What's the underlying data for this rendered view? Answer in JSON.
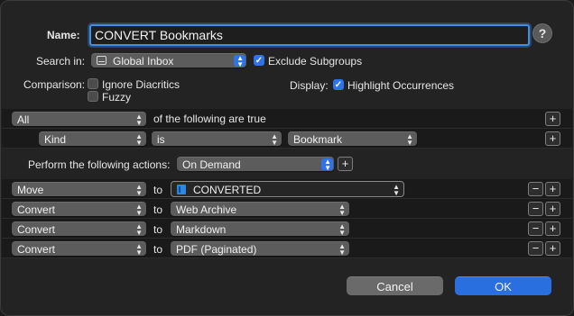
{
  "dialog": {
    "name_label": "Name:",
    "name_value": "CONVERT Bookmarks",
    "help_label": "?",
    "search_in_label": "Search in:",
    "search_in_value": "Global Inbox",
    "exclude_subgroups_label": "Exclude Subgroups",
    "exclude_subgroups_checked": true,
    "comparison_label": "Comparison:",
    "ignore_diacritics_label": "Ignore Diacritics",
    "ignore_diacritics_checked": false,
    "fuzzy_label": "Fuzzy",
    "fuzzy_checked": false,
    "display_label": "Display:",
    "highlight_label": "Highlight Occurrences",
    "highlight_checked": true
  },
  "conditions": {
    "match_value": "All",
    "match_suffix": "of the following are true",
    "rule": {
      "field": "Kind",
      "operator": "is",
      "value": "Bookmark"
    }
  },
  "actions": {
    "perform_label": "Perform the following actions:",
    "perform_value": "On Demand",
    "to_label": "to",
    "rows": [
      {
        "action": "Move",
        "target": "CONVERTED"
      },
      {
        "action": "Convert",
        "target": "Web Archive"
      },
      {
        "action": "Convert",
        "target": "Markdown"
      },
      {
        "action": "Convert",
        "target": "PDF (Paginated)"
      }
    ]
  },
  "buttons": {
    "plus": "+",
    "minus": "−",
    "cancel": "Cancel",
    "ok": "OK"
  },
  "colors": {
    "accent": "#2f73e8",
    "background": "#232323",
    "popup": "#5c5c5c"
  }
}
